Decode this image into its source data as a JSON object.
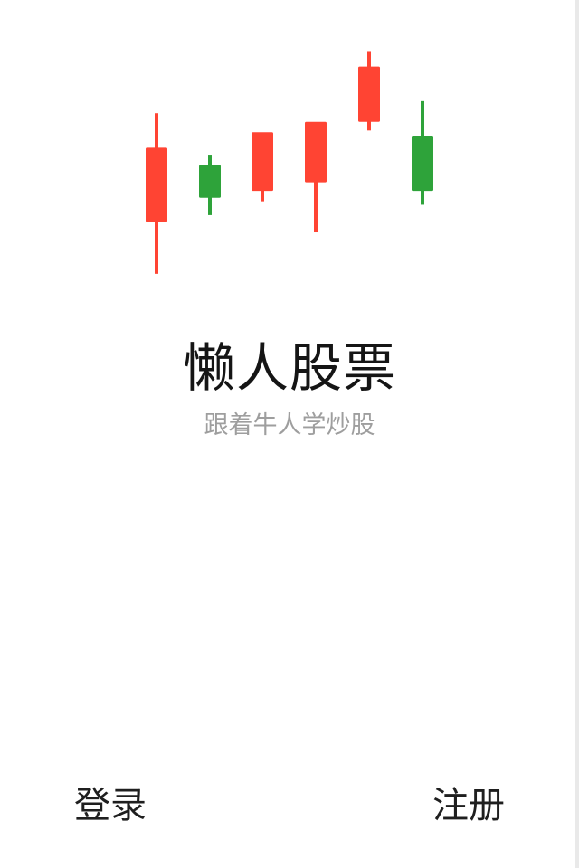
{
  "app": {
    "title": "懒人股票",
    "subtitle": "跟着牛人学炒股"
  },
  "actions": {
    "login_label": "登录",
    "register_label": "注册"
  },
  "colors": {
    "rise": "#FF4433",
    "fall": "#2EA33A",
    "background": "#FFFFFF",
    "edge": "#E9E9E9"
  },
  "chart_data": {
    "type": "candlestick",
    "candles": [
      {
        "open": 8.8,
        "close": 4.5,
        "high": 1.5,
        "low": 10.8,
        "trend": "rise"
      },
      {
        "open": 7.8,
        "close": 5.9,
        "high": 4.9,
        "low": 8.4,
        "trend": "fall"
      },
      {
        "open": 6.3,
        "close": 9.7,
        "high": 8.8,
        "low": 5.7,
        "trend": "rise"
      },
      {
        "open": 6.8,
        "close": 10.3,
        "high": 8.3,
        "low": 3.9,
        "trend": "rise"
      },
      {
        "open": 10.3,
        "close": 13.5,
        "high": 14.4,
        "low": 9.8,
        "trend": "rise"
      },
      {
        "open": 9.5,
        "close": 6.3,
        "high": 5.5,
        "low": 11.5,
        "trend": "fall"
      }
    ]
  }
}
